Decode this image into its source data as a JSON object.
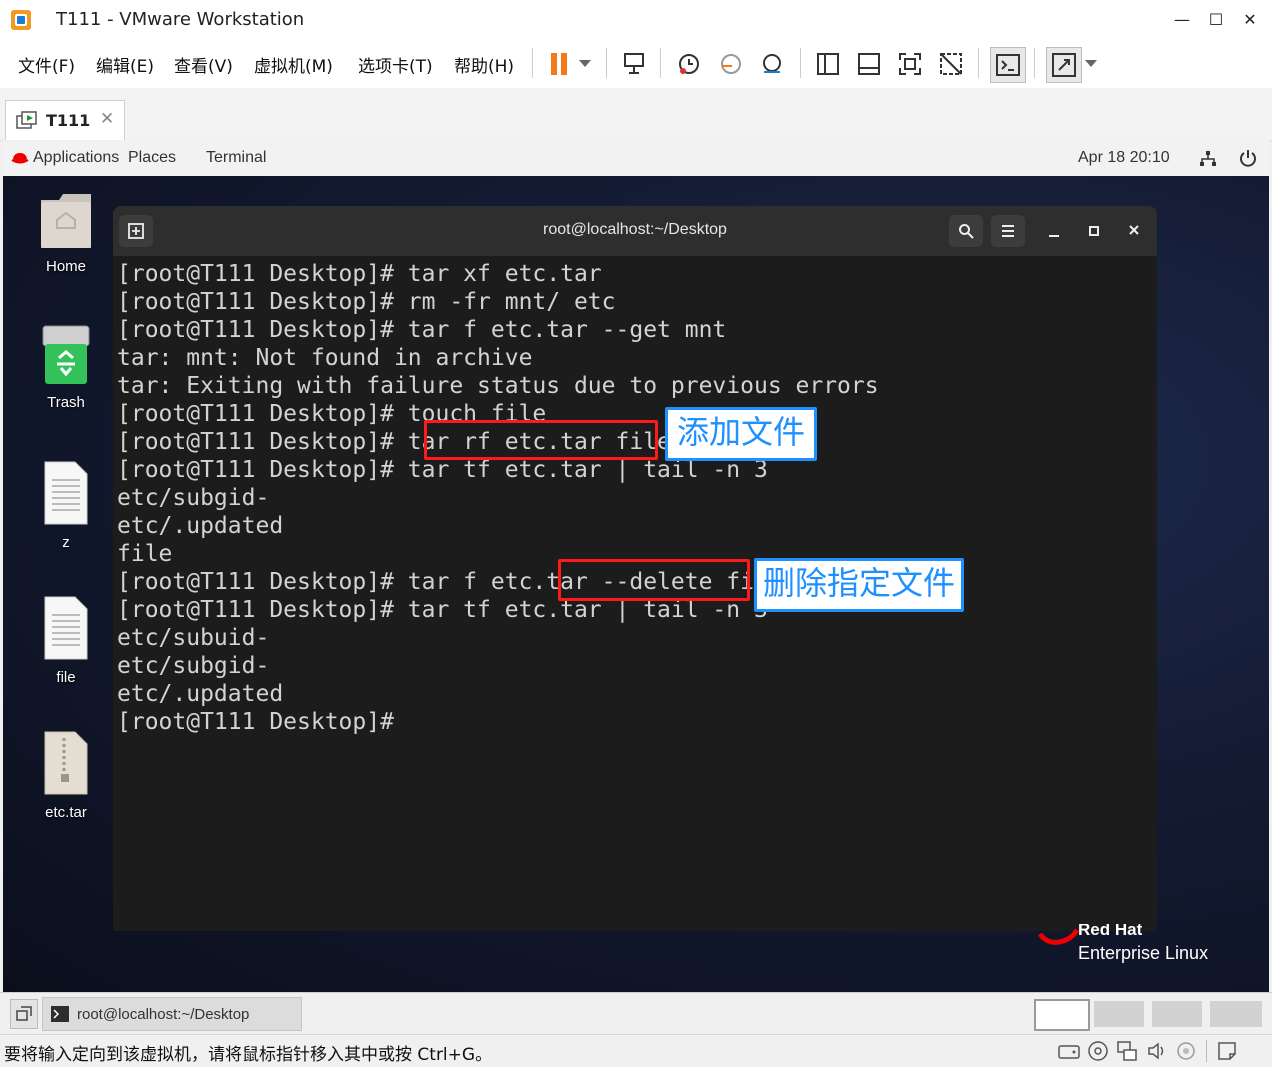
{
  "window": {
    "title": "T111 - VMware Workstation"
  },
  "menu": [
    "文件(F)",
    "编辑(E)",
    "查看(V)",
    "虚拟机(M)",
    "选项卡(T)",
    "帮助(H)"
  ],
  "vm_tab": {
    "label": "T111"
  },
  "gnome": {
    "applications": "Applications",
    "places": "Places",
    "terminal": "Terminal",
    "datetime": "Apr 18  20:10"
  },
  "desktop_icons": [
    "Home",
    "Trash",
    "z",
    "file",
    "etc.tar"
  ],
  "terminal": {
    "title": "root@localhost:~/Desktop",
    "lines": [
      "[root@T111 Desktop]# tar xf etc.tar",
      "[root@T111 Desktop]# rm -fr mnt/ etc",
      "[root@T111 Desktop]# tar f etc.tar --get mnt",
      "tar: mnt: Not found in archive",
      "tar: Exiting with failure status due to previous errors",
      "[root@T111 Desktop]# touch file",
      "[root@T111 Desktop]# tar rf etc.tar file",
      "[root@T111 Desktop]# tar tf etc.tar | tail -n 3",
      "etc/subgid-",
      "etc/.updated",
      "file",
      "[root@T111 Desktop]# tar f etc.tar --delete file",
      "[root@T111 Desktop]# tar tf etc.tar | tail -n 3",
      "etc/subuid-",
      "etc/subgid-",
      "etc/.updated",
      "[root@T111 Desktop]#"
    ]
  },
  "annotations": {
    "add_file": "添加文件",
    "delete_file": "删除指定文件"
  },
  "branding": {
    "line1": "Red Hat",
    "line2": "Enterprise Linux"
  },
  "taskbar": {
    "window_label": "root@localhost:~/Desktop"
  },
  "status": {
    "hint": "要将输入定向到该虚拟机，请将鼠标指针移入其中或按 Ctrl+G。"
  },
  "colors": {
    "annotation_red": "#ff1a1a",
    "annotation_blue": "#1e90ff",
    "pause_orange": "#f27a1a"
  }
}
